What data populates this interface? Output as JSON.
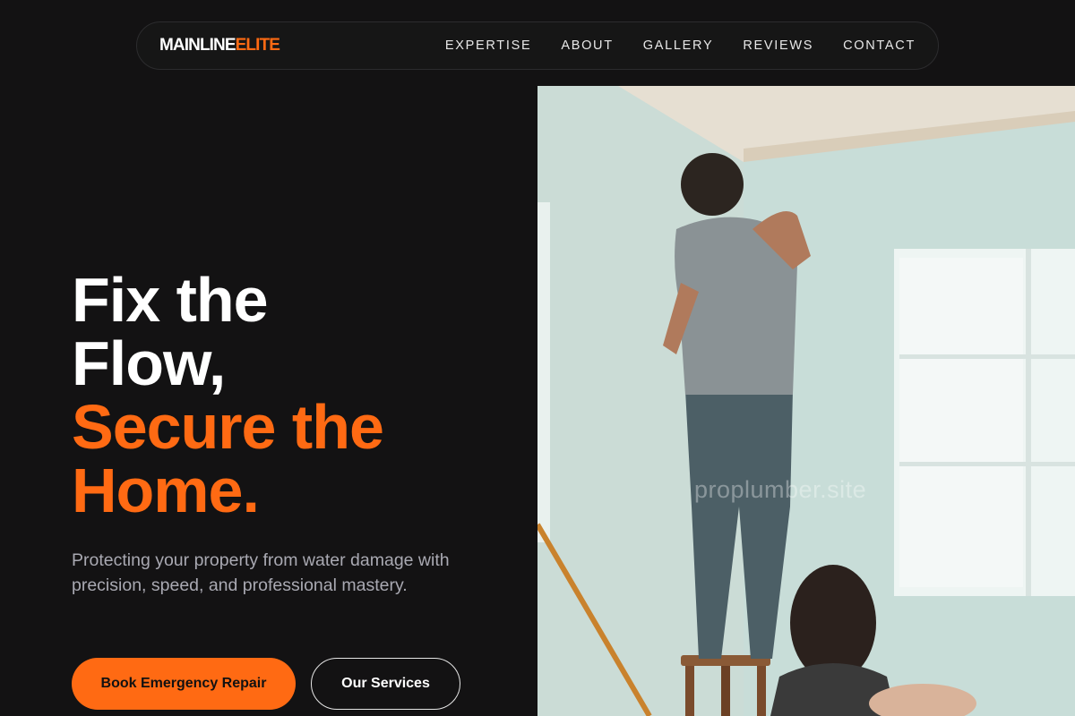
{
  "brand": {
    "name_part1": "MAINLINE",
    "name_part2": "ELITE"
  },
  "nav": {
    "items": [
      "EXPERTISE",
      "ABOUT",
      "GALLERY",
      "REVIEWS",
      "CONTACT"
    ]
  },
  "hero": {
    "line1": "Fix the",
    "line2": "Flow,",
    "line3": "Secure the",
    "line4": "Home.",
    "subtitle": "Protecting your property from water damage with precision, speed, and professional mastery.",
    "primary_button": "Book Emergency Repair",
    "secondary_button": "Our Services"
  },
  "image": {
    "watermark": "proplumber.site"
  },
  "colors": {
    "accent": "#ff6a13",
    "background": "#131213"
  }
}
